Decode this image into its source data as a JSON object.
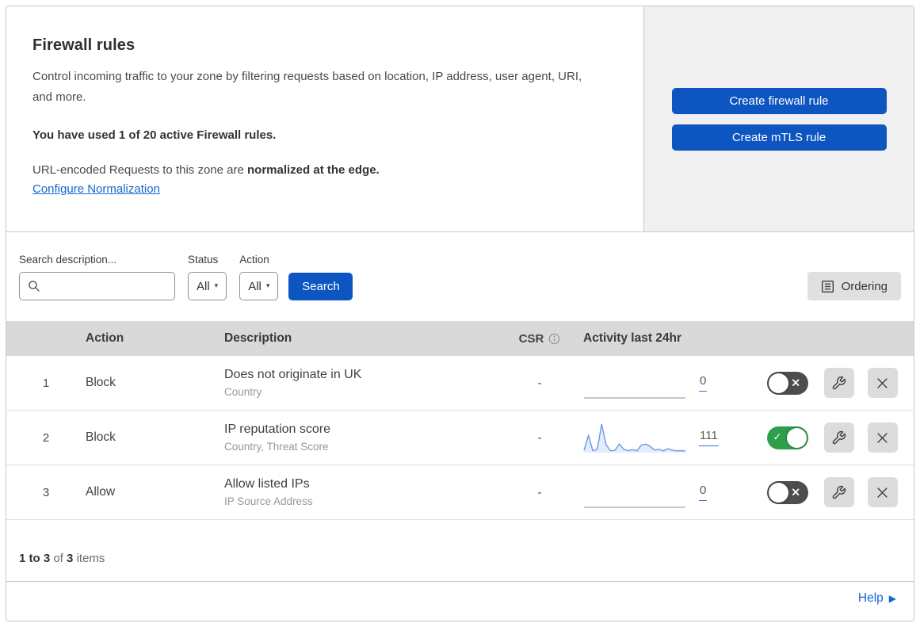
{
  "colors": {
    "primary_button": "#0d55c0",
    "link": "#1467cf",
    "toggle_on": "#2f9e4b",
    "toggle_off": "#4d4d4d",
    "sparkline": "#6d98e8",
    "sparkline_fill": "#e3ecfa",
    "sparkline_flat": "#b5b5b5",
    "header_bg": "#d9d9d9",
    "panel_bg": "#f0f0f0",
    "card_border": "#c6c6c6"
  },
  "intro": {
    "title": "Firewall rules",
    "description": "Control incoming traffic to your zone by filtering requests based on location, IP address, user agent, URI, and more.",
    "usage_note": "You have used 1 of 20 active Firewall rules.",
    "normalization_text": "URL-encoded Requests to this zone are ",
    "normalization_bold": "normalized at the edge.",
    "normalization_link": "Configure Normalization"
  },
  "actions": {
    "create_firewall_rule_label": "Create firewall rule",
    "create_mtls_rule_label": "Create mTLS rule"
  },
  "filters": {
    "search_label": "Search description...",
    "status_label": "Status",
    "status_value": "All",
    "action_label": "Action",
    "action_value": "All",
    "search_button_label": "Search",
    "ordering_button_label": "Ordering"
  },
  "table": {
    "headers": {
      "action": "Action",
      "description": "Description",
      "csr": "CSR",
      "activity": "Activity last 24hr"
    },
    "rows": [
      {
        "index": "1",
        "action": "Block",
        "description": "Does not originate in UK",
        "fields": "Country",
        "csr": "-",
        "activity_count": "0",
        "enabled": false,
        "sparkline": [
          0,
          0,
          0,
          0,
          0,
          0,
          0,
          0,
          0,
          0,
          0,
          0,
          0,
          0,
          0,
          0,
          0,
          0,
          0,
          0,
          0,
          0,
          0,
          0
        ]
      },
      {
        "index": "2",
        "action": "Block",
        "description": "IP reputation score",
        "fields": "Country, Threat Score",
        "csr": "-",
        "activity_count": "111",
        "enabled": true,
        "sparkline": [
          8,
          60,
          7,
          12,
          100,
          28,
          6,
          8,
          30,
          12,
          7,
          10,
          6,
          26,
          30,
          22,
          9,
          12,
          6,
          14,
          9,
          6,
          7,
          6
        ]
      },
      {
        "index": "3",
        "action": "Allow",
        "description": "Allow listed IPs",
        "fields": "IP Source Address",
        "csr": "-",
        "activity_count": "0",
        "enabled": false,
        "sparkline": [
          0,
          0,
          0,
          0,
          0,
          0,
          0,
          0,
          0,
          0,
          0,
          0,
          0,
          0,
          0,
          0,
          0,
          0,
          0,
          0,
          0,
          0,
          0,
          0
        ]
      }
    ]
  },
  "pagination": {
    "range": "1 to 3",
    "of_label": "of",
    "total": "3",
    "items_label": "items"
  },
  "help": {
    "label": "Help"
  }
}
